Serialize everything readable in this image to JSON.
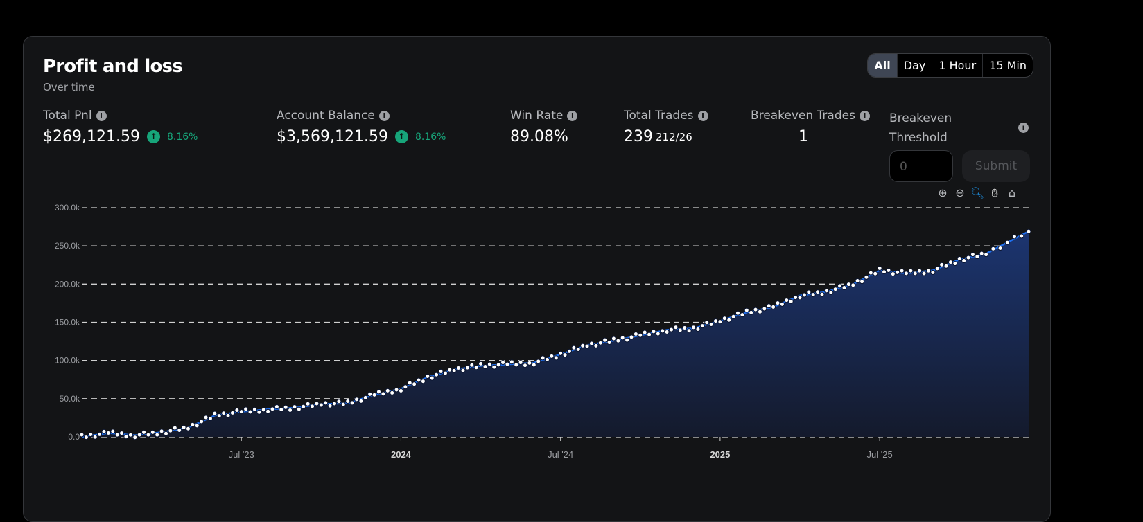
{
  "header": {
    "title": "Profit and loss",
    "subtitle": "Over time"
  },
  "timeframes": [
    "All",
    "Day",
    "1 Hour",
    "15 Min"
  ],
  "selected_timeframe": "All",
  "stats": {
    "total_pnl": {
      "label": "Total Pnl",
      "value": "$269,121.59",
      "change": "8.16%"
    },
    "account_balance": {
      "label": "Account Balance",
      "value": "$3,569,121.59",
      "change": "8.16%"
    },
    "win_rate": {
      "label": "Win Rate",
      "value": "89.08%"
    },
    "total_trades": {
      "label": "Total Trades",
      "value": "239",
      "sub": "212/26"
    },
    "breakeven_trades": {
      "label": "Breakeven Trades",
      "value": "1"
    },
    "breakeven_threshold": {
      "label": "Breakeven Threshold",
      "placeholder": "0",
      "submit": "Submit"
    }
  },
  "colors": {
    "line": "#1e6ff0",
    "area": "#1a2f63",
    "up": "#17a57a"
  },
  "chart_data": {
    "type": "area",
    "title": "",
    "xlabel": "",
    "ylabel": "",
    "ylim": [
      0,
      300000
    ],
    "y_ticks": [
      "0.0",
      "50.0k",
      "100.0k",
      "150.0k",
      "200.0k",
      "250.0k",
      "300.0k"
    ],
    "x_ticks": [
      {
        "label": "Jul '23",
        "month": 6,
        "bold": false
      },
      {
        "label": "2024",
        "month": 12,
        "bold": true
      },
      {
        "label": "Jul '24",
        "month": 18,
        "bold": false
      },
      {
        "label": "2025",
        "month": 24,
        "bold": true
      },
      {
        "label": "Jul '25",
        "month": 30,
        "bold": false
      }
    ],
    "x_unit": "months since Jan 2023",
    "xlim": [
      0,
      35.6
    ],
    "series": [
      {
        "name": "PnL",
        "x": [
          0,
          1,
          2,
          3,
          4,
          5,
          6,
          7,
          8,
          9,
          10,
          11,
          12,
          13,
          14,
          15,
          16,
          17,
          18,
          19,
          20,
          21,
          22,
          23,
          24,
          25,
          26,
          27,
          28,
          29,
          30,
          31,
          32,
          33,
          34,
          35.6
        ],
        "values": [
          0,
          5000,
          2000,
          6000,
          12000,
          28000,
          33000,
          36000,
          38000,
          43000,
          44000,
          55000,
          63000,
          78000,
          88000,
          93000,
          95000,
          97000,
          108000,
          120000,
          126000,
          133000,
          140000,
          142000,
          152000,
          163000,
          170000,
          185000,
          190000,
          200000,
          218000,
          214000,
          218000,
          232000,
          240000,
          269000
        ]
      }
    ],
    "grid": true,
    "legend": "none"
  }
}
